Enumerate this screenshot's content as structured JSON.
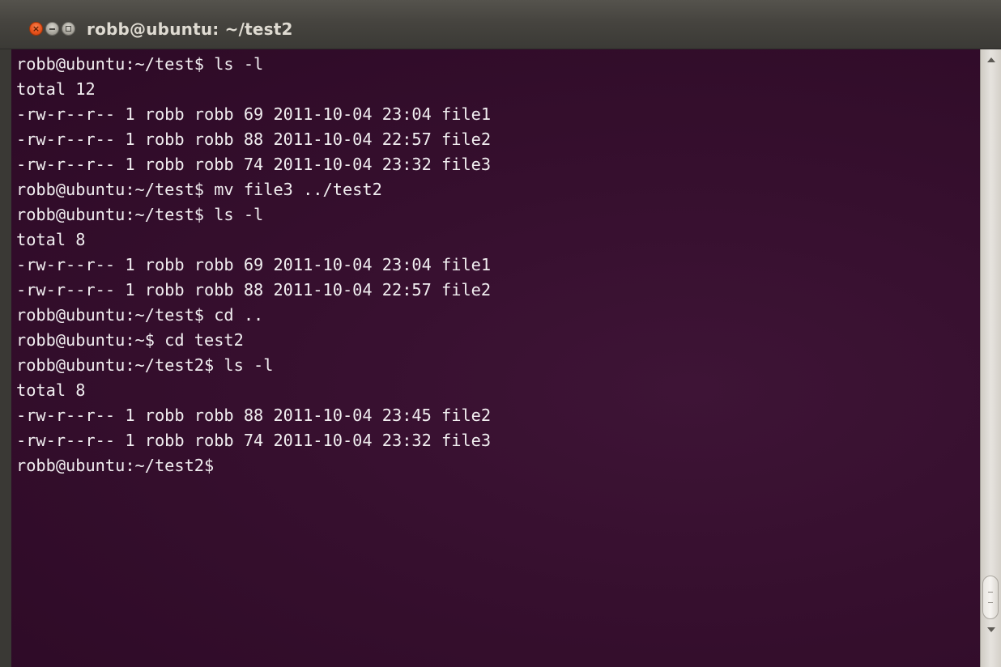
{
  "window": {
    "title": "robb@ubuntu: ~/test2",
    "close_glyph": "×",
    "buttons": [
      "close-icon",
      "minimize-icon",
      "maximize-icon"
    ]
  },
  "colors": {
    "terminal_background": "#360f2e",
    "terminal_text": "#f1eef0",
    "close_button": "#e8531d"
  },
  "terminal": {
    "lines": [
      "robb@ubuntu:~/test$ ls -l",
      "total 12",
      "-rw-r--r-- 1 robb robb 69 2011-10-04 23:04 file1",
      "-rw-r--r-- 1 robb robb 88 2011-10-04 22:57 file2",
      "-rw-r--r-- 1 robb robb 74 2011-10-04 23:32 file3",
      "robb@ubuntu:~/test$ mv file3 ../test2",
      "robb@ubuntu:~/test$ ls -l",
      "total 8",
      "-rw-r--r-- 1 robb robb 69 2011-10-04 23:04 file1",
      "-rw-r--r-- 1 robb robb 88 2011-10-04 22:57 file2",
      "robb@ubuntu:~/test$ cd ..",
      "robb@ubuntu:~$ cd test2",
      "robb@ubuntu:~/test2$ ls -l",
      "total 8",
      "-rw-r--r-- 1 robb robb 88 2011-10-04 23:45 file2",
      "-rw-r--r-- 1 robb robb 74 2011-10-04 23:32 file3",
      "robb@ubuntu:~/test2$"
    ]
  },
  "scrollbar": {
    "position": "bottom"
  }
}
